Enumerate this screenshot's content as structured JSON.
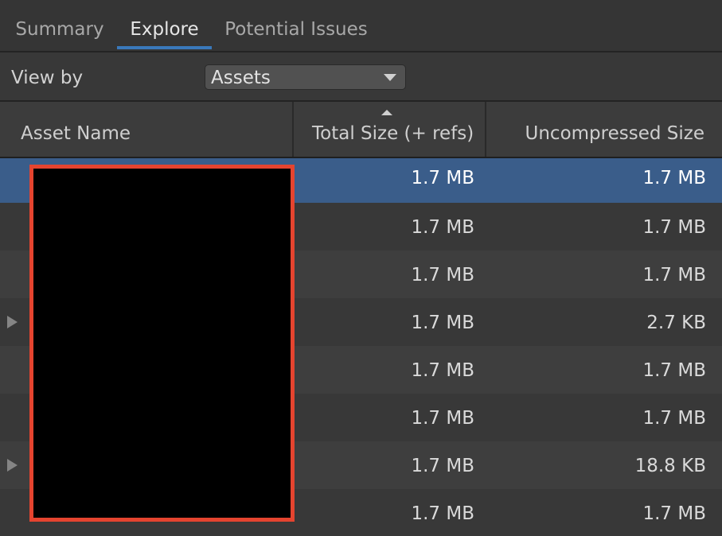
{
  "tabs": [
    {
      "label": "Summary",
      "active": false
    },
    {
      "label": "Explore",
      "active": true
    },
    {
      "label": "Potential Issues",
      "active": false
    }
  ],
  "toolbar": {
    "view_by_label": "View by",
    "view_by_value": "Assets"
  },
  "table": {
    "columns": {
      "name": "Asset Name",
      "total": "Total Size (+ refs)",
      "uncompressed": "Uncompressed Size"
    },
    "sort": {
      "column": "total",
      "direction": "ascending-arrow"
    },
    "rows": [
      {
        "total": "1.7 MB",
        "uncompressed": "1.7 MB",
        "selected": true,
        "expandable": false
      },
      {
        "total": "1.7 MB",
        "uncompressed": "1.7 MB",
        "selected": false,
        "expandable": false
      },
      {
        "total": "1.7 MB",
        "uncompressed": "1.7 MB",
        "selected": false,
        "expandable": false
      },
      {
        "total": "1.7 MB",
        "uncompressed": "2.7 KB",
        "selected": false,
        "expandable": true
      },
      {
        "total": "1.7 MB",
        "uncompressed": "1.7 MB",
        "selected": false,
        "expandable": false
      },
      {
        "total": "1.7 MB",
        "uncompressed": "1.7 MB",
        "selected": false,
        "expandable": false
      },
      {
        "total": "1.7 MB",
        "uncompressed": "18.8 KB",
        "selected": false,
        "expandable": true
      },
      {
        "total": "1.7 MB",
        "uncompressed": "1.7 MB",
        "selected": false,
        "expandable": false
      }
    ]
  },
  "icons": {
    "dropdown": "chevron-down-icon",
    "sort": "sort-ascending-icon",
    "expand": "expand-arrow-icon"
  },
  "colors": {
    "accent": "#3a79bb",
    "selected_row": "#3a5d8a",
    "redaction_border": "#e5442f"
  }
}
